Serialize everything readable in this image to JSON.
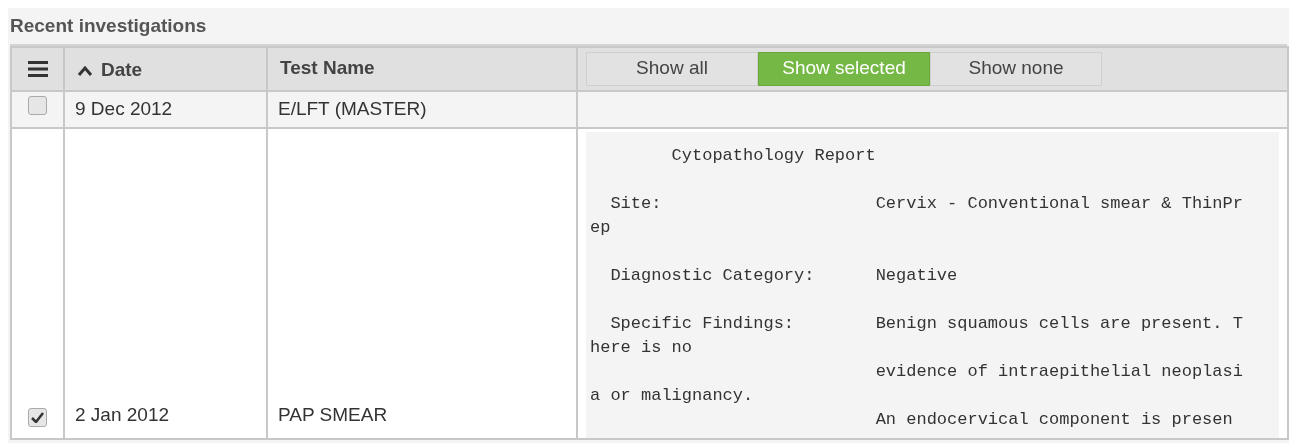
{
  "panel": {
    "title": "Recent investigations"
  },
  "table": {
    "columns": [
      {
        "label": "Date",
        "sorted_ascending": true
      },
      {
        "label": "Test Name"
      }
    ],
    "filter_buttons": [
      {
        "label": "Show all",
        "selected": false
      },
      {
        "label": "Show selected",
        "selected": true
      },
      {
        "label": "Show none",
        "selected": false
      }
    ],
    "rows": [
      {
        "checked": false,
        "date": "9 Dec 2012",
        "test_name": "E/LFT (MASTER)"
      },
      {
        "checked": true,
        "date": "2 Jan 2012",
        "test_name": "PAP SMEAR",
        "report": "        Cytopathology Report\n\n  Site:                     Cervix - Conventional smear & ThinPr\nep\n\n  Diagnostic Category:      Negative\n\n  Specific Findings:        Benign squamous cells are present. T\nhere is no\n                            evidence of intraepithelial neoplasi\na or malignancy.\n                            An endocervical component is presen"
      }
    ]
  }
}
